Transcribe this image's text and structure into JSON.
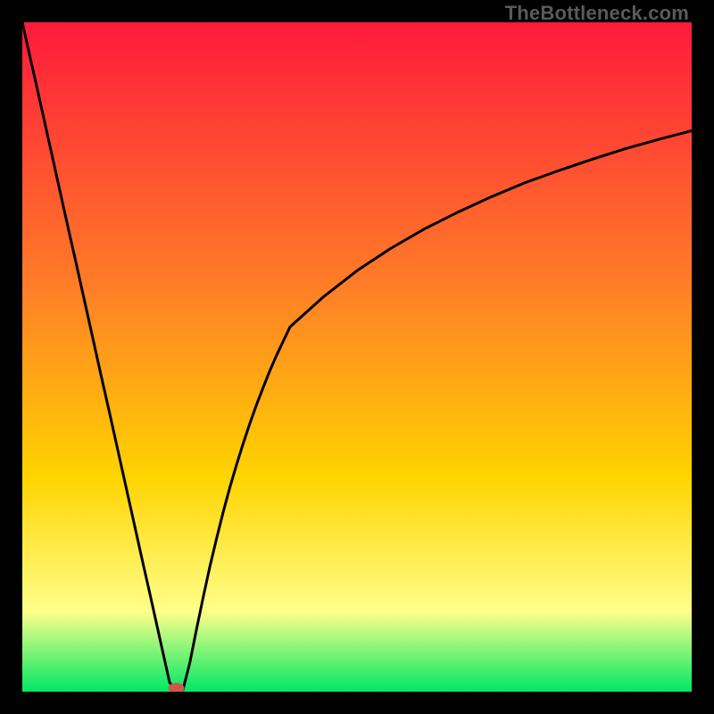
{
  "watermark": "TheBottleneck.com",
  "colors": {
    "gradient_top": "#ff1a3c",
    "gradient_mid1": "#ff7f27",
    "gradient_mid2": "#ffd400",
    "gradient_light": "#ffff8a",
    "gradient_bottom": "#00e864",
    "curve": "#000000",
    "marker": "#cc5a4a",
    "frame": "#000000"
  },
  "chart_data": {
    "type": "line",
    "title": "",
    "xlabel": "",
    "ylabel": "",
    "xlim": [
      0,
      100
    ],
    "ylim": [
      0,
      100
    ],
    "x": [
      0,
      1,
      2,
      3,
      4,
      5,
      6,
      7,
      8,
      9,
      10,
      11,
      12,
      13,
      14,
      15,
      16,
      17,
      18,
      19,
      20,
      21,
      22,
      23,
      24,
      25,
      26,
      27,
      28,
      29,
      30,
      31,
      32,
      33,
      34,
      35,
      36,
      37,
      38,
      39,
      40,
      45,
      50,
      55,
      60,
      65,
      70,
      75,
      80,
      85,
      90,
      95,
      100
    ],
    "values": [
      100.0,
      95.5,
      91.1,
      86.6,
      82.1,
      77.6,
      73.1,
      68.6,
      64.2,
      59.7,
      55.2,
      50.7,
      46.2,
      41.8,
      37.3,
      32.8,
      28.3,
      23.8,
      19.3,
      14.9,
      10.4,
      5.9,
      1.4,
      0.0,
      0.3,
      4.2,
      9.2,
      14.0,
      18.6,
      22.8,
      26.8,
      30.5,
      33.9,
      37.1,
      40.1,
      42.9,
      45.5,
      48.0,
      50.3,
      52.4,
      54.5,
      59.0,
      62.9,
      66.2,
      69.1,
      71.6,
      73.9,
      76.0,
      77.8,
      79.5,
      81.1,
      82.5,
      83.8
    ],
    "marker": {
      "x": 23,
      "y": 0
    }
  }
}
